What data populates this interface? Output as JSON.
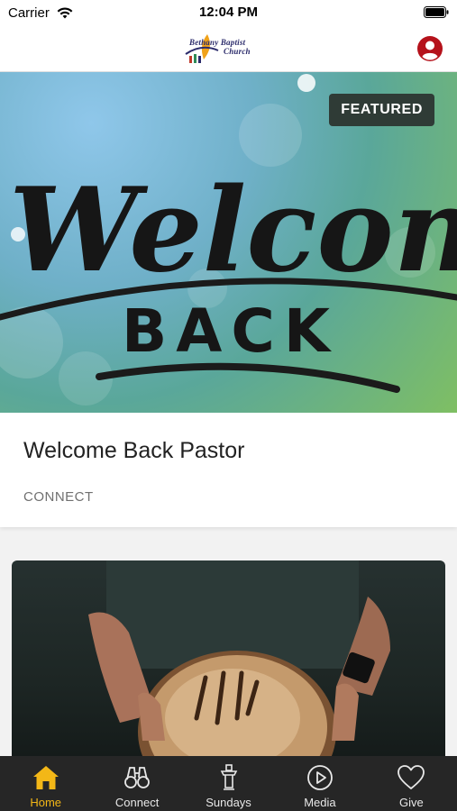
{
  "status_bar": {
    "carrier": "Carrier",
    "time": "12:04 PM"
  },
  "header": {
    "logo_line1": "Bethany Baptist",
    "logo_line2": "Church",
    "profile_icon": "user-circle-icon",
    "accent_color": "#b5121b"
  },
  "featured_card": {
    "badge": "FEATURED",
    "image_text_script": "Welcome",
    "image_text_block": "BACK",
    "title": "Welcome Back Pastor",
    "category": "CONNECT"
  },
  "second_card": {
    "image": "hands-holding-bread"
  },
  "tabs": [
    {
      "label": "Home",
      "icon": "home-icon",
      "active": true
    },
    {
      "label": "Connect",
      "icon": "binoculars-icon",
      "active": false
    },
    {
      "label": "Sundays",
      "icon": "pulpit-icon",
      "active": false
    },
    {
      "label": "Media",
      "icon": "play-circle-icon",
      "active": false
    },
    {
      "label": "Give",
      "icon": "heart-icon",
      "active": false
    }
  ],
  "colors": {
    "tab_active": "#f3b717",
    "tab_bar_bg": "#262626",
    "badge_bg": "#2f3b36"
  }
}
